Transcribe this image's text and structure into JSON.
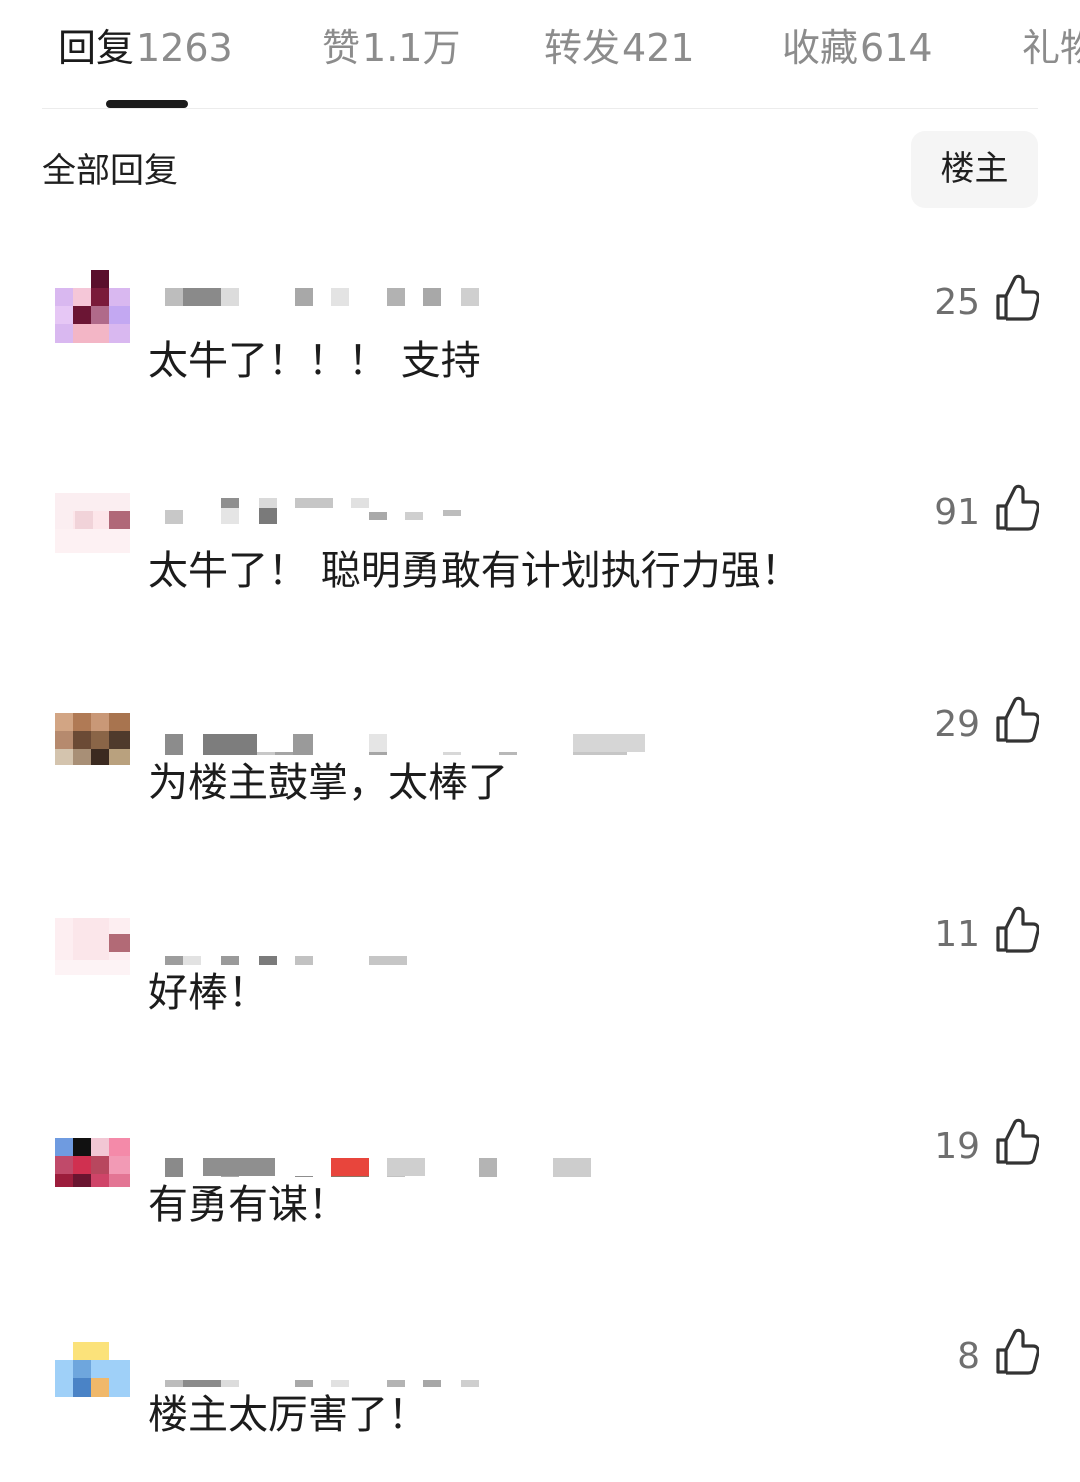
{
  "tabs": [
    {
      "name": "回复",
      "count": "1263"
    },
    {
      "name": "赞",
      "count": "1.1万"
    },
    {
      "name": "转发",
      "count": "421"
    },
    {
      "name": "收藏",
      "count": "614"
    },
    {
      "name": "礼物",
      "count": ""
    }
  ],
  "section": {
    "title": "全部回复",
    "filter_label": "楼主"
  },
  "comments": [
    {
      "text": "太牛了！！！ 支持",
      "likes": "25"
    },
    {
      "text": "太牛了！ 聪明勇敢有计划执行力强！",
      "likes": "91"
    },
    {
      "text": "为楼主鼓掌，太棒了",
      "likes": "29"
    },
    {
      "text": "好棒！",
      "likes": "11"
    },
    {
      "text": "有勇有谋！",
      "likes": "19"
    },
    {
      "text": "楼主太厉害了！",
      "likes": "8"
    }
  ],
  "colors": {
    "active_tab": "#1b1b1b",
    "inactive_tab": "#8c8c8c",
    "like_count": "#6f6f6f"
  },
  "icons": {
    "like": "thumbs-up-icon"
  }
}
